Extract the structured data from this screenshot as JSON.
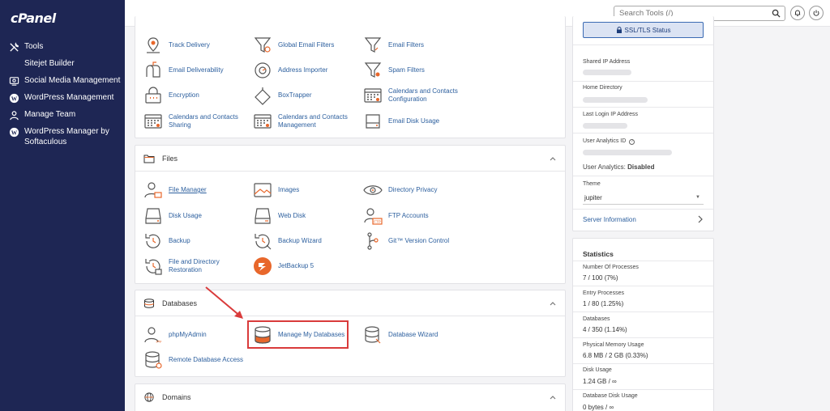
{
  "brand": {
    "logo": "cPanel"
  },
  "sidebar": {
    "items": [
      {
        "label": "Tools",
        "icon": "tools-icon"
      },
      {
        "label": "Sitejet Builder",
        "icon": "sitejet-icon"
      },
      {
        "label": "Social Media Management",
        "icon": "social-icon"
      },
      {
        "label": "WordPress Management",
        "icon": "wordpress-icon"
      },
      {
        "label": "Manage Team",
        "icon": "team-icon"
      },
      {
        "label": "WordPress Manager by Softaculous",
        "icon": "wordpress-icon"
      }
    ]
  },
  "topbar": {
    "search_placeholder": "Search Tools (/)"
  },
  "email_section": {
    "tools": [
      {
        "label": "Track Delivery",
        "icon": "track-delivery-icon"
      },
      {
        "label": "Global Email Filters",
        "icon": "filter-icon"
      },
      {
        "label": "Email Filters",
        "icon": "filter-icon"
      },
      {
        "label": "Email Deliverability",
        "icon": "mailbox-icon"
      },
      {
        "label": "Address Importer",
        "icon": "address-importer-icon"
      },
      {
        "label": "Spam Filters",
        "icon": "filter-icon"
      },
      {
        "label": "Encryption",
        "icon": "encryption-icon"
      },
      {
        "label": "BoxTrapper",
        "icon": "boxtrapper-icon"
      },
      {
        "label": "Calendars and Contacts Configuration",
        "icon": "calendar-icon"
      },
      {
        "label": "Calendars and Contacts Sharing",
        "icon": "calendar-icon"
      },
      {
        "label": "Calendars and Contacts Management",
        "icon": "calendar-icon"
      },
      {
        "label": "Email Disk Usage",
        "icon": "disk-usage-icon"
      }
    ]
  },
  "files_section": {
    "title": "Files",
    "tools": [
      {
        "label": "File Manager",
        "icon": "file-manager-icon"
      },
      {
        "label": "Images",
        "icon": "images-icon"
      },
      {
        "label": "Directory Privacy",
        "icon": "eye-icon"
      },
      {
        "label": "Disk Usage",
        "icon": "disk-icon"
      },
      {
        "label": "Web Disk",
        "icon": "web-disk-icon"
      },
      {
        "label": "FTP Accounts",
        "icon": "ftp-icon"
      },
      {
        "label": "Backup",
        "icon": "backup-icon"
      },
      {
        "label": "Backup Wizard",
        "icon": "backup-wizard-icon"
      },
      {
        "label": "Git™ Version Control",
        "icon": "git-icon"
      },
      {
        "label": "File and Directory Restoration",
        "icon": "restore-icon"
      },
      {
        "label": "JetBackup 5",
        "icon": "jetbackup-icon"
      }
    ]
  },
  "databases_section": {
    "title": "Databases",
    "tools": [
      {
        "label": "phpMyAdmin",
        "icon": "phpmyadmin-icon"
      },
      {
        "label": "Manage My Databases",
        "icon": "database-icon"
      },
      {
        "label": "Database Wizard",
        "icon": "database-wizard-icon"
      },
      {
        "label": "Remote Database Access",
        "icon": "remote-database-icon"
      }
    ]
  },
  "domains_section": {
    "title": "Domains"
  },
  "general_info": {
    "ssl_button": "SSL/TLS Status",
    "shared_ip_label": "Shared IP Address",
    "home_dir_label": "Home Directory",
    "last_login_label": "Last Login IP Address",
    "analytics_id_label": "User Analytics ID",
    "analytics_status_label": "User Analytics:",
    "analytics_status_value": "Disabled",
    "theme_label": "Theme",
    "theme_value": "jupiter",
    "server_info_label": "Server Information"
  },
  "statistics": {
    "title": "Statistics",
    "items": [
      {
        "label": "Number Of Processes",
        "value": "7 / 100   (7%)"
      },
      {
        "label": "Entry Processes",
        "value": "1 / 80   (1.25%)"
      },
      {
        "label": "Databases",
        "value": "4 / 350   (1.14%)"
      },
      {
        "label": "Physical Memory Usage",
        "value": "6.8 MB / 2 GB   (0.33%)"
      },
      {
        "label": "Disk Usage",
        "value": "1.24 GB / ∞"
      },
      {
        "label": "Database Disk Usage",
        "value": "0 bytes / ∞"
      }
    ]
  },
  "colors": {
    "sidebar": "#1e2654",
    "link": "#2c5f9e",
    "accent": "#e8672b",
    "highlight": "#d93b3b"
  }
}
